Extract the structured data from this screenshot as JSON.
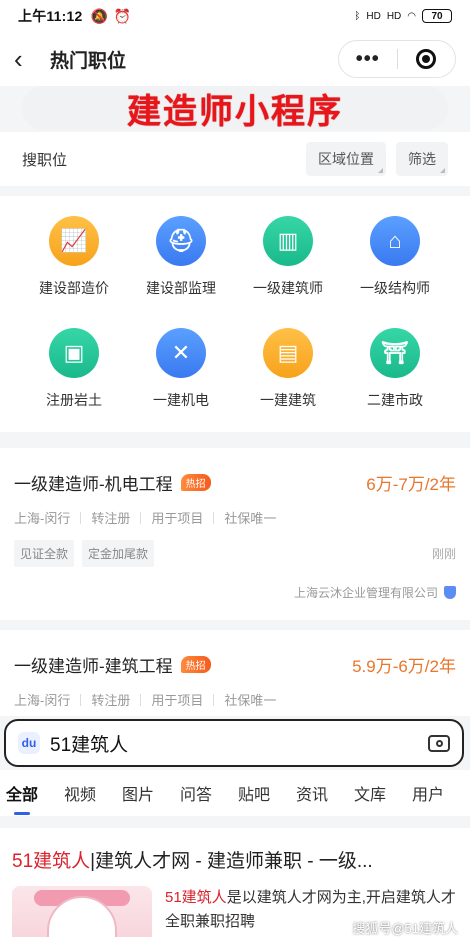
{
  "status_bar": {
    "time": "上午11:12",
    "signal1": "HD",
    "signal2": "HD",
    "battery": "70"
  },
  "navbar": {
    "title": "热门职位",
    "more": "•••"
  },
  "banner": {
    "text": "建造师小程序"
  },
  "filter": {
    "label": "搜职位",
    "area": "区域位置",
    "screen": "筛选"
  },
  "categories": [
    {
      "label": "建设部造价",
      "icon": "chart-up-icon",
      "color": "#f7a21b"
    },
    {
      "label": "建设部监理",
      "icon": "helmet-icon",
      "color": "#3a79f0"
    },
    {
      "label": "一级建筑师",
      "icon": "building-icon",
      "color": "#19b98c"
    },
    {
      "label": "一级结构师",
      "icon": "house-structure-icon",
      "color": "#3a79f0"
    },
    {
      "label": "注册岩土",
      "icon": "mine-cart-icon",
      "color": "#19b98c"
    },
    {
      "label": "一建机电",
      "icon": "tools-icon",
      "color": "#3a79f0"
    },
    {
      "label": "一建建筑",
      "icon": "office-building-icon",
      "color": "#f7a21b"
    },
    {
      "label": "二建市政",
      "icon": "civic-building-icon",
      "color": "#19b98c"
    }
  ],
  "jobs": [
    {
      "title": "一级建造师-机电工程",
      "hot": "热招",
      "salary": "6万-7万/2年",
      "meta": [
        "上海-闵行",
        "转注册",
        "用于项目",
        "社保唯一"
      ],
      "tags": [
        "见证全款",
        "定金加尾款"
      ],
      "time": "刚刚",
      "company": "上海云沐企业管理有限公司"
    },
    {
      "title": "一级建造师-建筑工程",
      "hot": "热招",
      "salary": "5.9万-6万/2年",
      "meta": [
        "上海-闵行",
        "转注册",
        "用于项目",
        "社保唯一"
      ]
    }
  ],
  "search": {
    "query": "51建筑人"
  },
  "tabs": [
    "全部",
    "视频",
    "图片",
    "问答",
    "贴吧",
    "资讯",
    "文库",
    "用户"
  ],
  "result": {
    "title_hl": "51建筑人",
    "title_rest": "|建筑人才网 - 建造师兼职 - 一级...",
    "desc_hl": "51建筑人",
    "desc_rest": "是以建筑人才网为主,开启建筑人才全职兼职招聘",
    "watermark": "搜狐号@51建筑人"
  }
}
